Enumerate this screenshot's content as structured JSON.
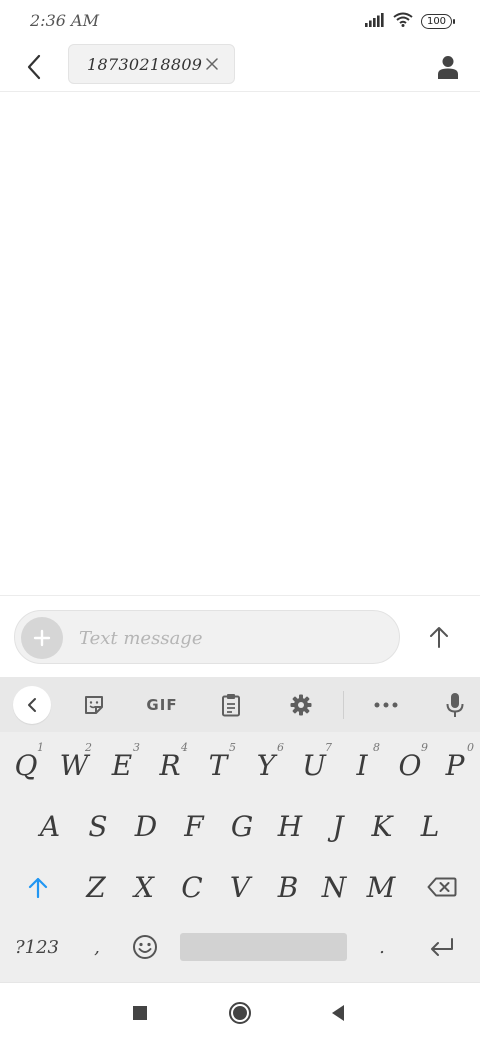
{
  "status_bar": {
    "time": "2:36 AM",
    "battery": "100",
    "icons": [
      "signal-icon",
      "wifi-icon",
      "battery-icon"
    ]
  },
  "header": {
    "recipient": "18730218809",
    "back_icon": "back-arrow-icon",
    "remove_icon": "close-icon",
    "contact_icon": "person-icon"
  },
  "compose": {
    "placeholder": "Text message",
    "add_icon": "plus-icon",
    "send_icon": "send-arrow-icon"
  },
  "keyboard": {
    "toolbar": {
      "collapse_icon": "chevron-left-icon",
      "sticker_icon": "sticker-icon",
      "gif_label": "GIF",
      "clipboard_icon": "clipboard-icon",
      "settings_icon": "gear-icon",
      "more_icon": "more-dots-icon",
      "mic_icon": "microphone-icon"
    },
    "row1": [
      {
        "key": "Q",
        "hint": "1"
      },
      {
        "key": "W",
        "hint": "2"
      },
      {
        "key": "E",
        "hint": "3"
      },
      {
        "key": "R",
        "hint": "4"
      },
      {
        "key": "T",
        "hint": "5"
      },
      {
        "key": "Y",
        "hint": "6"
      },
      {
        "key": "U",
        "hint": "7"
      },
      {
        "key": "I",
        "hint": "8"
      },
      {
        "key": "O",
        "hint": "9"
      },
      {
        "key": "P",
        "hint": "0"
      }
    ],
    "row2": [
      "A",
      "S",
      "D",
      "F",
      "G",
      "H",
      "J",
      "K",
      "L"
    ],
    "row3": [
      "Z",
      "X",
      "C",
      "V",
      "B",
      "N",
      "M"
    ],
    "symbols_label": "?123",
    "comma": ",",
    "period": ".",
    "accent_color": "#2196f3"
  },
  "nav_bar": {
    "recents_icon": "square-icon",
    "home_icon": "circle-icon",
    "back_icon": "triangle-back-icon"
  }
}
